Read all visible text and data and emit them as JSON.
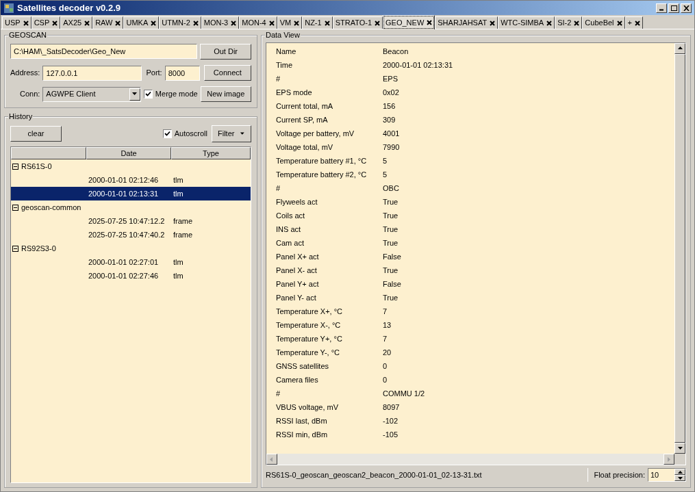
{
  "window": {
    "title": "Satellites decoder v0.2.9"
  },
  "tabs": [
    {
      "label": "USP",
      "selected": false
    },
    {
      "label": "CSP",
      "selected": false
    },
    {
      "label": "AX25",
      "selected": false
    },
    {
      "label": "RAW",
      "selected": false
    },
    {
      "label": "UMKA",
      "selected": false
    },
    {
      "label": "UTMN-2",
      "selected": false
    },
    {
      "label": "MON-3",
      "selected": false
    },
    {
      "label": "MON-4",
      "selected": false
    },
    {
      "label": "VM",
      "selected": false
    },
    {
      "label": "NZ-1",
      "selected": false
    },
    {
      "label": "STRATO-1",
      "selected": false
    },
    {
      "label": "GEO_NEW",
      "selected": true
    },
    {
      "label": "SHARJAHSAT",
      "selected": false
    },
    {
      "label": "WTC-SIMBA",
      "selected": false
    },
    {
      "label": "SI-2",
      "selected": false
    },
    {
      "label": "CubeBel",
      "selected": false
    },
    {
      "label": "+",
      "selected": false
    }
  ],
  "geoscan": {
    "title": "GEOSCAN",
    "out_dir": "C:\\HAM\\_SatsDecoder\\Geo_New",
    "out_dir_button": "Out Dir",
    "address_label": "Address:",
    "address": "127.0.0.1",
    "port_label": "Port:",
    "port": "8000",
    "connect_button": "Connect",
    "conn_label": "Conn:",
    "conn": "AGWPE Client",
    "merge_mode": {
      "label": "Merge mode",
      "checked": true
    },
    "new_image_button": "New image"
  },
  "history": {
    "title": "History",
    "clear_button": "clear",
    "autoscroll": {
      "label": "Autoscroll",
      "checked": true
    },
    "filter_button": "Filter",
    "columns": [
      "Date",
      "Type"
    ],
    "items": [
      {
        "name": "RS61S-0",
        "expanded": true,
        "children": [
          {
            "date": "2000-01-01 02:12:46",
            "type": "tlm",
            "selected": false
          },
          {
            "date": "2000-01-01 02:13:31",
            "type": "tlm",
            "selected": true
          }
        ]
      },
      {
        "name": "geoscan-common",
        "expanded": true,
        "children": [
          {
            "date": "2025-07-25 10:47:12.2",
            "type": "frame",
            "selected": false
          },
          {
            "date": "2025-07-25 10:47:40.2",
            "type": "frame",
            "selected": false
          }
        ]
      },
      {
        "name": "RS92S3-0",
        "expanded": true,
        "children": [
          {
            "date": "2000-01-01 02:27:01",
            "type": "tlm",
            "selected": false
          },
          {
            "date": "2000-01-01 02:27:46",
            "type": "tlm",
            "selected": false
          }
        ]
      }
    ]
  },
  "data_view": {
    "title": "Data View",
    "rows": [
      {
        "name": "Name",
        "value": "Beacon"
      },
      {
        "name": "Time",
        "value": "2000-01-01 02:13:31"
      },
      {
        "name": "#",
        "value": "EPS"
      },
      {
        "name": "EPS mode",
        "value": "0x02"
      },
      {
        "name": "Current total, mA",
        "value": "156"
      },
      {
        "name": "Current SP, mA",
        "value": "309"
      },
      {
        "name": "Voltage per battery, mV",
        "value": "4001"
      },
      {
        "name": "Voltage total, mV",
        "value": "7990"
      },
      {
        "name": "Temperature battery #1, °C",
        "value": "5"
      },
      {
        "name": "Temperature battery #2, °C",
        "value": "5"
      },
      {
        "name": "#",
        "value": "OBC"
      },
      {
        "name": "Flyweels act",
        "value": "True"
      },
      {
        "name": "Coils act",
        "value": "True"
      },
      {
        "name": "INS act",
        "value": "True"
      },
      {
        "name": "Cam act",
        "value": "True"
      },
      {
        "name": "Panel X+ act",
        "value": "False"
      },
      {
        "name": "Panel X- act",
        "value": "True"
      },
      {
        "name": "Panel Y+ act",
        "value": "False"
      },
      {
        "name": "Panel Y- act",
        "value": "True"
      },
      {
        "name": "Temperature X+, °C",
        "value": "7"
      },
      {
        "name": "Temperature X-, °C",
        "value": "13"
      },
      {
        "name": "Temperature Y+, °C",
        "value": "7"
      },
      {
        "name": "Temperature Y-, °C",
        "value": "20"
      },
      {
        "name": "GNSS satellites",
        "value": "0"
      },
      {
        "name": "Camera files",
        "value": "0"
      },
      {
        "name": "#",
        "value": "COMMU 1/2"
      },
      {
        "name": "VBUS voltage, mV",
        "value": "8097"
      },
      {
        "name": "RSSI last, dBm",
        "value": "-102"
      },
      {
        "name": "RSSI min, dBm",
        "value": "-105"
      }
    ]
  },
  "status": {
    "file": "RS61S-0_geoscan_geoscan2_beacon_2000-01-01_02-13-31.txt",
    "precision_label": "Float precision:",
    "precision": "10"
  }
}
